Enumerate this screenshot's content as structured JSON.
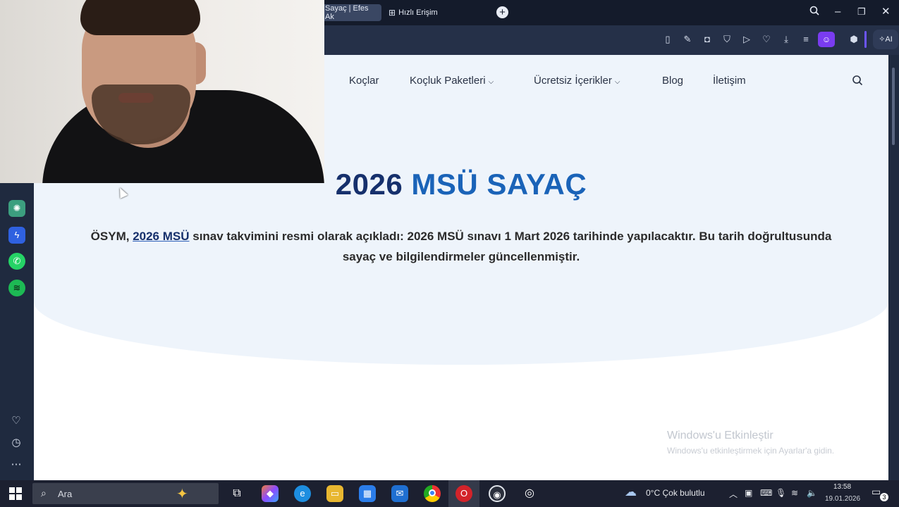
{
  "browser": {
    "tabs": [
      {
        "label": "Sayaç | Efes Ak",
        "active": true
      },
      {
        "label": "Hızlı Erişim",
        "icon": "grid-icon",
        "active": false
      }
    ],
    "ai_label": "AI",
    "toolbar_icons": [
      "split-view-icon",
      "edit-icon",
      "camera-icon",
      "shield-icon",
      "play-icon",
      "heart-icon",
      "download-icon",
      "menu-icon",
      "profile-icon",
      "cube-icon"
    ],
    "sidebar_apps": [
      "chatgpt-icon",
      "messenger-icon",
      "whatsapp-icon",
      "spotify-icon"
    ],
    "sidebar_bottom": [
      "heart-icon",
      "history-icon",
      "more-icon"
    ]
  },
  "site": {
    "nav": {
      "coaches": "Koçlar",
      "packages": "Koçluk Paketleri",
      "free_content": "Ücretsiz İçerikler",
      "blog": "Blog",
      "contact": "İletişim"
    },
    "heading_part1": "2026",
    "heading_part2": "MSÜ SAYAÇ",
    "desc_prefix": "ÖSYM, ",
    "desc_link": "2026 MSÜ",
    "desc_line1_rest": " sınav takvimini resmi olarak açıkladı: 2026 MSÜ sınavı 1 Mart 2026 tarihinde yapılacaktır. Bu tarih doğrultusunda",
    "desc_line2": "sayaç ve bilgilendirmeler güncellenmiştir.",
    "watermark_title": "Windows'u Etkinleştir",
    "watermark_sub": "Windows'u etkinleştirmek için Ayarlar'a gidin."
  },
  "taskbar": {
    "search_placeholder": "Ara",
    "weather": "0°C  Çok bulutlu",
    "time": "13:58",
    "date": "19.01.2026",
    "notification_count": "3"
  },
  "colors": {
    "heading_dark": "#16306c",
    "heading_blue": "#1a63b8",
    "hero_bg": "#eef4fb",
    "browser_chrome": "#1f2a3f",
    "profile_accent": "#7a3cf0"
  }
}
